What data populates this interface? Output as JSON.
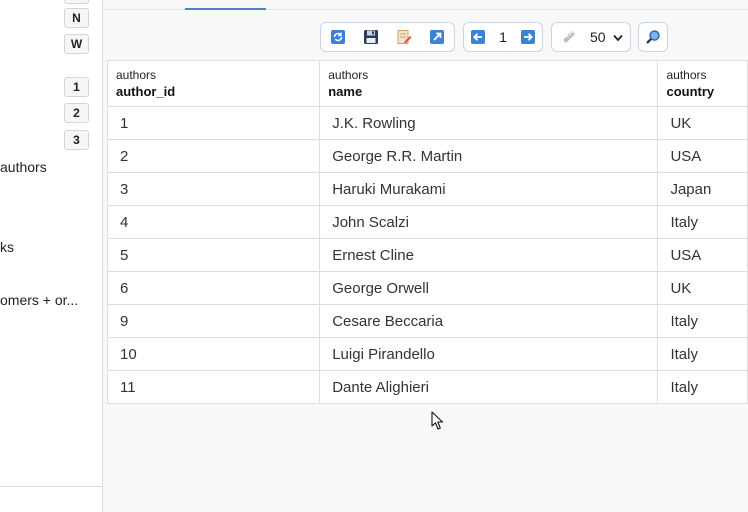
{
  "sidebar": {
    "buttons_top": [
      "N",
      "W"
    ],
    "buttons_pages": [
      "1",
      "2",
      "3"
    ],
    "items": [
      "authors",
      "ks",
      "omers + or..."
    ]
  },
  "toolbar": {
    "page_number": "1",
    "rows_per_page": "50"
  },
  "table": {
    "columns": [
      {
        "table": "authors",
        "name": "author_id"
      },
      {
        "table": "authors",
        "name": "name"
      },
      {
        "table": "authors",
        "name": "country"
      }
    ],
    "rows": [
      {
        "author_id": "1",
        "name": "J.K. Rowling",
        "country": "UK"
      },
      {
        "author_id": "2",
        "name": "George R.R. Martin",
        "country": "USA"
      },
      {
        "author_id": "3",
        "name": "Haruki Murakami",
        "country": "Japan"
      },
      {
        "author_id": "4",
        "name": "John Scalzi",
        "country": "Italy"
      },
      {
        "author_id": "5",
        "name": "Ernest Cline",
        "country": "USA"
      },
      {
        "author_id": "6",
        "name": "George Orwell",
        "country": "UK"
      },
      {
        "author_id": "9",
        "name": "Cesare Beccaria",
        "country": "Italy"
      },
      {
        "author_id": "10",
        "name": "Luigi Pirandello",
        "country": "Italy"
      },
      {
        "author_id": "11",
        "name": "Dante Alighieri",
        "country": "Italy"
      }
    ]
  },
  "colors": {
    "accent": "#4a7fc9",
    "border": "#dedede",
    "toolbar_border": "#c9d6ea"
  }
}
